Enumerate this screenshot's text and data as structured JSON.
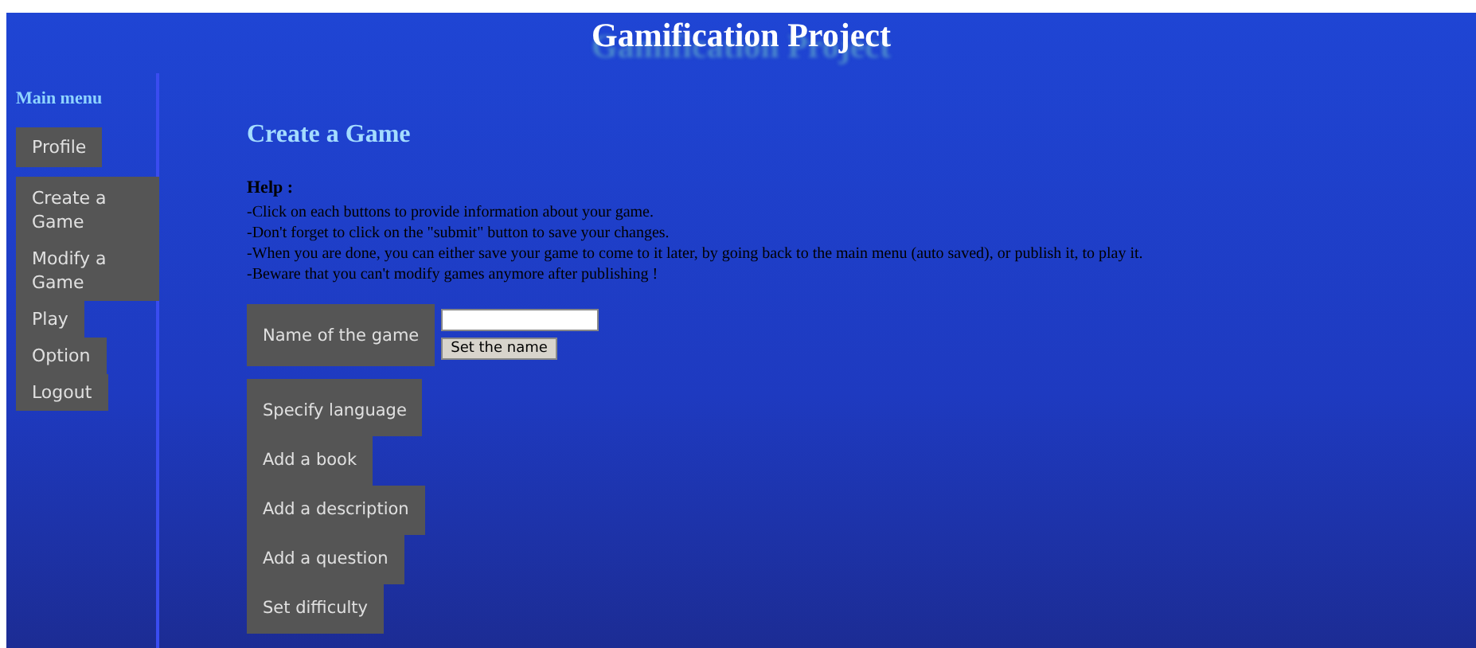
{
  "header": {
    "title": "Gamification Project"
  },
  "sidebar": {
    "heading": "Main menu",
    "items": [
      {
        "label": "Profile"
      },
      {
        "label": "Create a Game"
      },
      {
        "label": "Modify a Game"
      },
      {
        "label": "Play"
      },
      {
        "label": "Option"
      },
      {
        "label": "Logout"
      }
    ]
  },
  "main": {
    "title": "Create a Game",
    "help_heading": "Help :",
    "help_lines": [
      "-Click on each buttons to provide information about your game.",
      "-Don't forget to click on the \"submit\" button to save your changes.",
      "-When you are done, you can either save your game to come to it later, by going back to the main menu (auto saved), or publish it, to play it.",
      "-Beware that you can't modify games anymore after publishing !"
    ],
    "name_field": {
      "label": "Name of the game",
      "button": "Set the name"
    },
    "actions": [
      "Specify language",
      "Add a book",
      "Add a description",
      "Add a question",
      "Set difficulty"
    ]
  }
}
